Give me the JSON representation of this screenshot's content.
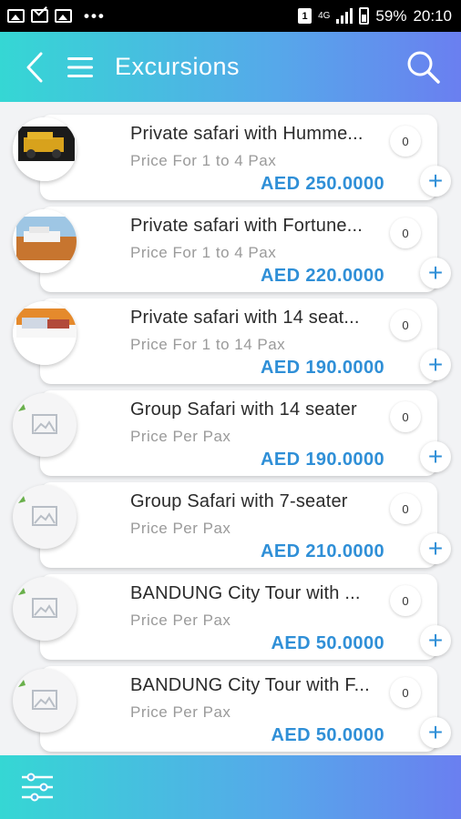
{
  "status_bar": {
    "network": "4G",
    "battery": "59%",
    "time": "20:10",
    "more": "•••",
    "sim": "1"
  },
  "appbar": {
    "title": "Excursions",
    "back_icon": "back-arrow-icon",
    "menu_icon": "menu-icon",
    "search_icon": "search-icon"
  },
  "items": [
    {
      "name": "Private safari with Humme...",
      "sub": "Price For 1 to 4 Pax",
      "price": "AED 250.0000",
      "qty": "0",
      "image": "hummer-photo"
    },
    {
      "name": "Private safari with Fortune...",
      "sub": "Price For 1 to 4 Pax",
      "price": "AED 220.0000",
      "qty": "0",
      "image": "fortuner-photo"
    },
    {
      "name": "Private safari with 14 seat...",
      "sub": "Price For 1 to 14 Pax",
      "price": "AED 190.0000",
      "qty": "0",
      "image": "minibus-photo"
    },
    {
      "name": "Group Safari with 14 seater",
      "sub": "Price Per Pax",
      "price": "AED 190.0000",
      "qty": "0",
      "image": "placeholder"
    },
    {
      "name": "Group Safari with 7-seater",
      "sub": "Price Per Pax",
      "price": "AED 210.0000",
      "qty": "0",
      "image": "placeholder"
    },
    {
      "name": "BANDUNG City Tour with ...",
      "sub": "Price Per Pax",
      "price": "AED 50.0000",
      "qty": "0",
      "image": "placeholder"
    },
    {
      "name": "BANDUNG City Tour with F...",
      "sub": "Price Per Pax",
      "price": "AED 50.0000",
      "qty": "0",
      "image": "placeholder"
    }
  ],
  "bottom_bar": {
    "filter_icon": "filter-sliders-icon"
  },
  "colors": {
    "accent": "#2f8fd7",
    "gradient_start": "#35d7d4",
    "gradient_end": "#6a7ff0"
  }
}
